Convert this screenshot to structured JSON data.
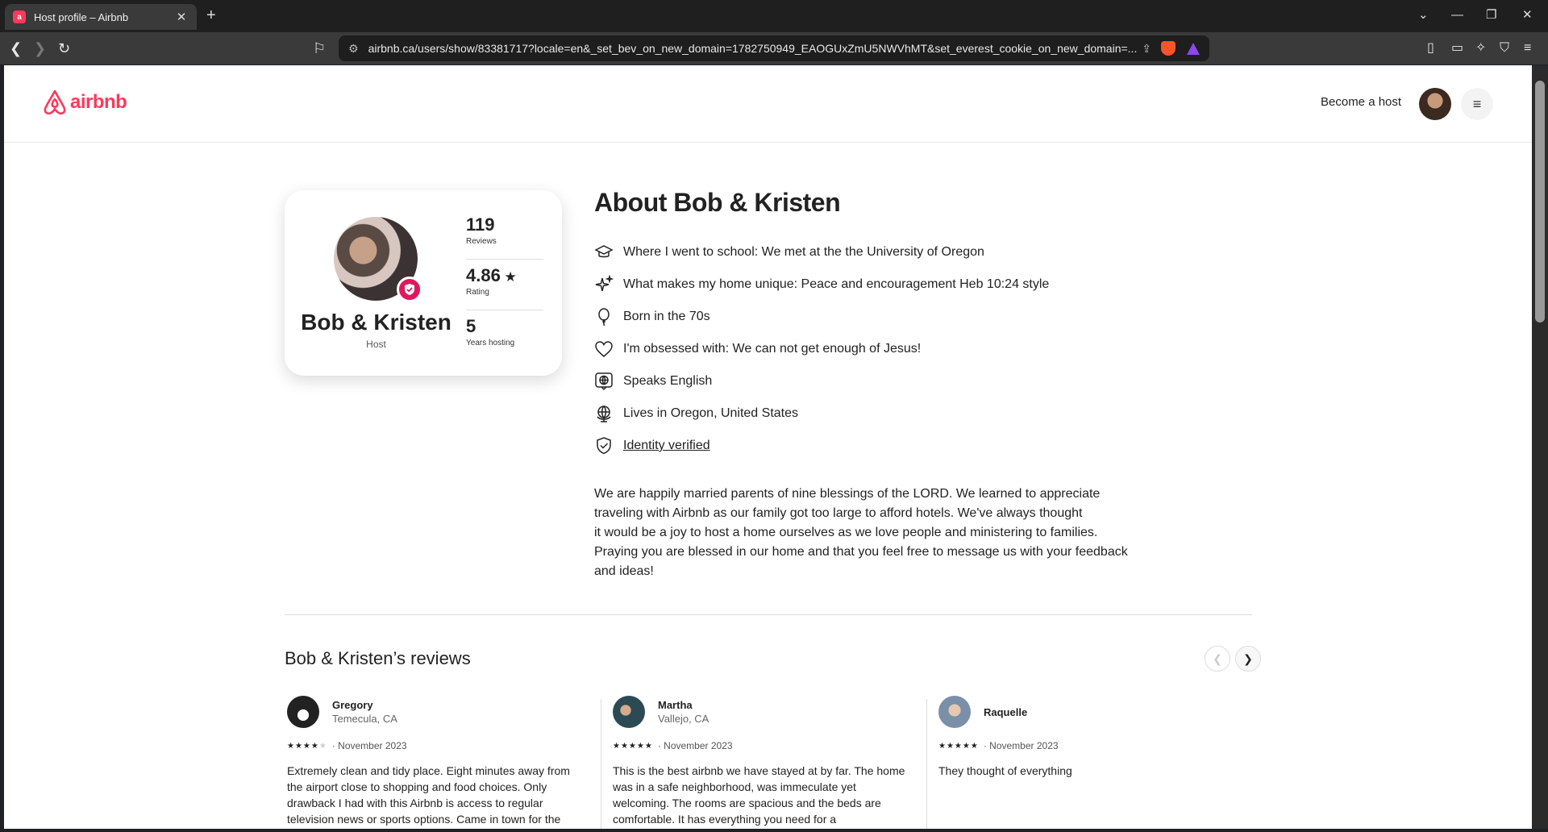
{
  "browser": {
    "tab_title": "Host profile – Airbnb",
    "url": "airbnb.ca/users/show/83381717?locale=en&_set_bev_on_new_domain=1782750949_EAOGUxZmU5NWVhMT&set_everest_cookie_on_new_domain=..."
  },
  "header": {
    "logo_text": "airbnb",
    "become_host": "Become a host"
  },
  "profile": {
    "name": "Bob & Kristen",
    "role": "Host",
    "stats": [
      {
        "value": "119",
        "label": "Reviews"
      },
      {
        "value": "4.86",
        "label": "Rating"
      },
      {
        "value": "5",
        "label": "Years hosting"
      }
    ]
  },
  "about": {
    "title": "About Bob & Kristen",
    "facts": [
      {
        "icon": "graduation-cap-icon",
        "text": "Where I went to school: We met at the the University of Oregon"
      },
      {
        "icon": "sparkles-icon",
        "text": "What makes my home unique: Peace and encouragement Heb 10:24 style"
      },
      {
        "icon": "balloon-icon",
        "text": "Born in the 70s"
      },
      {
        "icon": "heart-icon",
        "text": "I'm obsessed with: We can not get enough of Jesus!"
      },
      {
        "icon": "language-icon",
        "text": "Speaks English"
      },
      {
        "icon": "globe-icon",
        "text": "Lives in Oregon, United States"
      },
      {
        "icon": "shield-check-icon",
        "text": "Identity verified"
      }
    ],
    "bio_lines": [
      "We are happily married parents of nine blessings of the LORD. We learned to appreciate",
      "traveling with Airbnb as our family got too large to afford hotels. We've always thought",
      "it would be a joy to host a home ourselves as we love people and ministering to families.",
      "Praying you are blessed in our home and that you feel free to message us with your feedback",
      "and ideas!"
    ]
  },
  "reviews": {
    "title": "Bob & Kristen’s reviews",
    "items": [
      {
        "name": "Gregory",
        "location": "Temecula, CA",
        "rating": 4,
        "date": "November 2023",
        "text_lines": [
          "Extremely clean and tidy place. Eight minutes away from",
          "the airport close to shopping and food choices. Only",
          "drawback I had with this Airbnb is access to regular",
          "television news or sports options. Came in town for the"
        ]
      },
      {
        "name": "Martha",
        "location": "Vallejo, CA",
        "rating": 5,
        "date": "November 2023",
        "text_lines": [
          "This is the best airbnb we have stayed at by far.  The home",
          "was in a safe neighborhood, was immeculate yet",
          "welcoming.  The rooms are spacious and the beds are",
          "comfortable.   It has everything you need for a"
        ]
      },
      {
        "name": "Raquelle",
        "location": "",
        "rating": 5,
        "date": "November 2023",
        "text_lines": [
          "They thought of everything"
        ]
      }
    ]
  },
  "colors": {
    "brand": "#ff385c",
    "badge": "#e0185b"
  }
}
